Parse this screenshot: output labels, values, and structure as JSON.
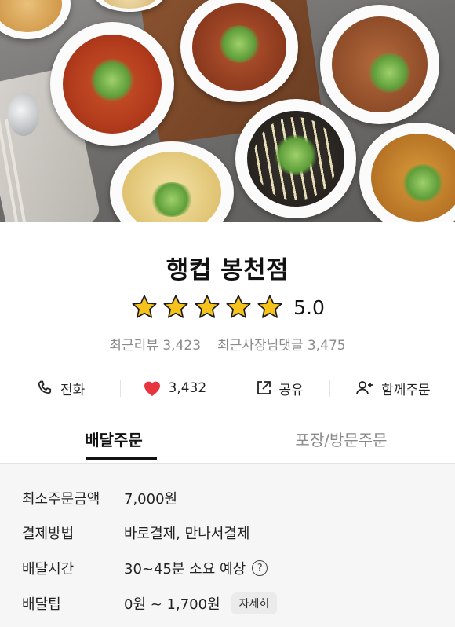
{
  "hero": {
    "image": "food-bowls-photo"
  },
  "store": {
    "name": "행컵 봉천점",
    "rating": "5.0",
    "stars": 5,
    "reviews_label": "최근리뷰 3,423",
    "owner_replies_label": "최근사장님댓글 3,475"
  },
  "actions": {
    "call_label": "전화",
    "like_count": "3,432",
    "share_label": "공유",
    "group_order_label": "함께주문"
  },
  "tabs": {
    "delivery": "배달주문",
    "pickup": "포장/방문주문",
    "active": "delivery"
  },
  "info": {
    "min_order_label": "최소주문금액",
    "min_order_value": "7,000원",
    "payment_label": "결제방법",
    "payment_value": "바로결제, 만나서결제",
    "time_label": "배달시간",
    "time_value": "30~45분 소요 예상",
    "tip_label": "배달팁",
    "tip_value": "0원 ~ 1,700원",
    "detail_button": "자세히",
    "help_glyph": "?"
  },
  "colors": {
    "star": "#f6c21c",
    "heart": "#e8343f",
    "text_primary": "#111111",
    "text_muted": "#8a8a8a",
    "info_bg": "#f6f6f6"
  }
}
